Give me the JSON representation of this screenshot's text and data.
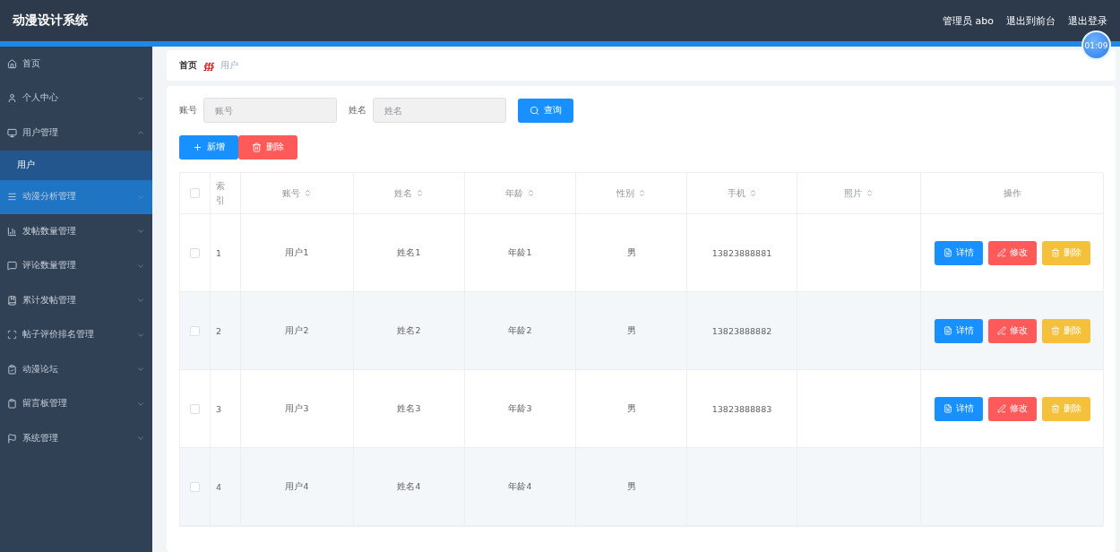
{
  "header": {
    "title": "动漫设计系统",
    "user": "管理员 abo",
    "links": [
      "退出到前台",
      "退出登录"
    ],
    "clock": "01:09"
  },
  "sidebar": {
    "items": [
      {
        "label": "首页",
        "hovered": false
      },
      {
        "label": "个人中心",
        "expanded": false,
        "hovered": false
      },
      {
        "label": "用户管理",
        "expanded": true,
        "hovered": false,
        "children": [
          {
            "label": "用户",
            "selected": true
          }
        ]
      },
      {
        "label": "动漫分析管理",
        "expanded": false,
        "hovered": true
      },
      {
        "label": "发帖数量管理",
        "expanded": false,
        "hovered": false
      },
      {
        "label": "评论数量管理",
        "expanded": false,
        "hovered": false
      },
      {
        "label": "累计发帖管理",
        "expanded": false,
        "hovered": false
      },
      {
        "label": "帖子评价排名管理",
        "expanded": false,
        "hovered": false
      },
      {
        "label": "动漫论坛",
        "expanded": false,
        "hovered": false
      },
      {
        "label": "留言板管理",
        "expanded": false,
        "hovered": false
      },
      {
        "label": "系统管理",
        "expanded": false,
        "hovered": false
      }
    ]
  },
  "breadcrumb": {
    "home": "首页",
    "separator": "∰",
    "current": "用户"
  },
  "search": {
    "fields": [
      {
        "label": "账号",
        "placeholder": "账号"
      },
      {
        "label": "姓名",
        "placeholder": "姓名"
      }
    ],
    "button": "查询"
  },
  "actions": [
    {
      "label": "新增",
      "kind": "add"
    },
    {
      "label": "删除",
      "kind": "delete"
    }
  ],
  "table": {
    "columns": [
      {
        "label": "索引",
        "sortable": false
      },
      {
        "label": "账号",
        "sortable": true
      },
      {
        "label": "姓名",
        "sortable": true
      },
      {
        "label": "年龄",
        "sortable": true
      },
      {
        "label": "性别",
        "sortable": true
      },
      {
        "label": "手机",
        "sortable": true
      },
      {
        "label": "照片",
        "sortable": true
      },
      {
        "label": "操作",
        "sortable": false
      }
    ],
    "header_checked": false,
    "rows": [
      {
        "checked": false,
        "cells": [
          "1",
          "用户1",
          "姓名1",
          "年龄1",
          "男",
          "13823888881",
          ""
        ],
        "buttons": [
          {
            "label": "详情",
            "kind": "detail"
          },
          {
            "label": "修改",
            "kind": "edit"
          },
          {
            "label": "删除",
            "kind": "delete"
          }
        ]
      },
      {
        "checked": false,
        "cells": [
          "2",
          "用户2",
          "姓名2",
          "年龄2",
          "男",
          "13823888882",
          ""
        ],
        "buttons": [
          {
            "label": "详情",
            "kind": "detail"
          },
          {
            "label": "修改",
            "kind": "edit"
          },
          {
            "label": "删除",
            "kind": "delete"
          }
        ]
      },
      {
        "checked": false,
        "cells": [
          "3",
          "用户3",
          "姓名3",
          "年龄3",
          "男",
          "13823888883",
          ""
        ],
        "buttons": [
          {
            "label": "详情",
            "kind": "detail"
          },
          {
            "label": "修改",
            "kind": "edit"
          },
          {
            "label": "删除",
            "kind": "delete"
          }
        ]
      },
      {
        "checked": false,
        "cells": [
          "4",
          "用户4",
          "姓名4",
          "年龄4",
          "男",
          "",
          ""
        ]
      }
    ]
  }
}
